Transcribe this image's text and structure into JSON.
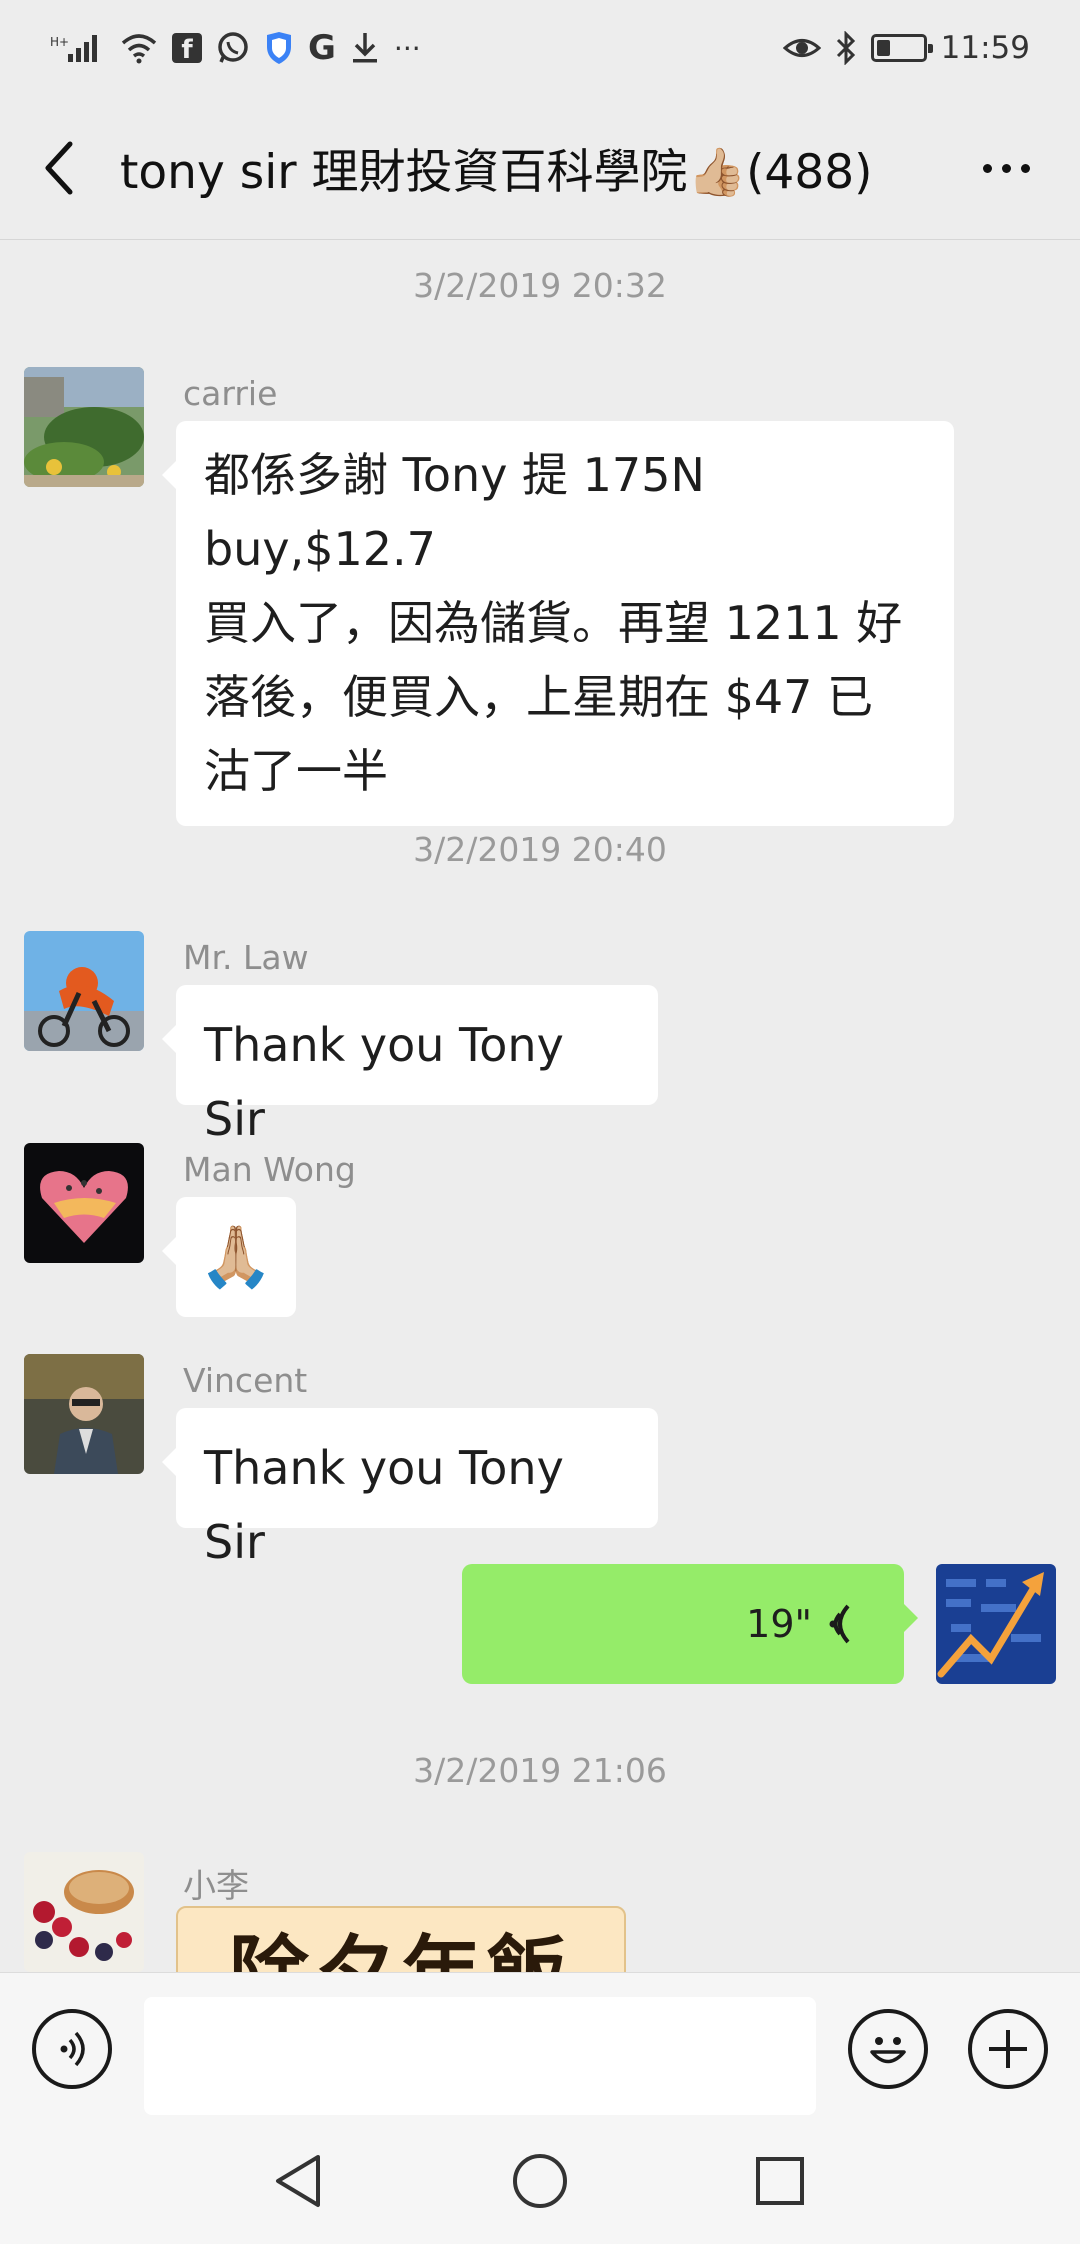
{
  "status_bar": {
    "left_icons": [
      "signal-icon",
      "wifi-icon",
      "facebook-icon",
      "whatsapp-icon",
      "shield-icon",
      "google-icon",
      "download-icon",
      "more-dots-icon"
    ],
    "more_text": "···",
    "google_letter": "G",
    "facebook_letter": "f",
    "right_icons": [
      "eye-icon",
      "bluetooth-icon",
      "battery-icon"
    ],
    "battery_level": 0.3,
    "time": "11:59"
  },
  "header": {
    "title": "tony sir 理財投資百科學院",
    "emoji": "👍🏼",
    "member_count": "(488)"
  },
  "messages": {
    "ts1": "3/2/2019 20:32",
    "carrie": {
      "sender": "carrie",
      "lines": [
        "都係多謝 Tony 提 175N buy,$12.7",
        "買入了，因為儲貨。再望 1211 好",
        "落後，便買入，上星期在 $47 已",
        "沽了一半"
      ]
    },
    "ts2": "3/2/2019 20:40",
    "mrlaw": {
      "sender": "Mr. Law",
      "text": "Thank you Tony Sir"
    },
    "manwong": {
      "sender": "Man Wong",
      "emoji": "🙏🏼"
    },
    "vincent": {
      "sender": "Vincent",
      "text": "Thank you Tony Sir"
    },
    "me_voice": {
      "duration": "19\""
    },
    "ts3": "3/2/2019 21:06",
    "xiaoli": {
      "sender": "小李",
      "image_text": "除夕年飯"
    }
  },
  "input_bar": {
    "placeholder": ""
  },
  "colors": {
    "background": "#ededed",
    "my_bubble": "#95ec69",
    "other_bubble": "#ffffff",
    "timestamp": "#9a9a9a"
  }
}
